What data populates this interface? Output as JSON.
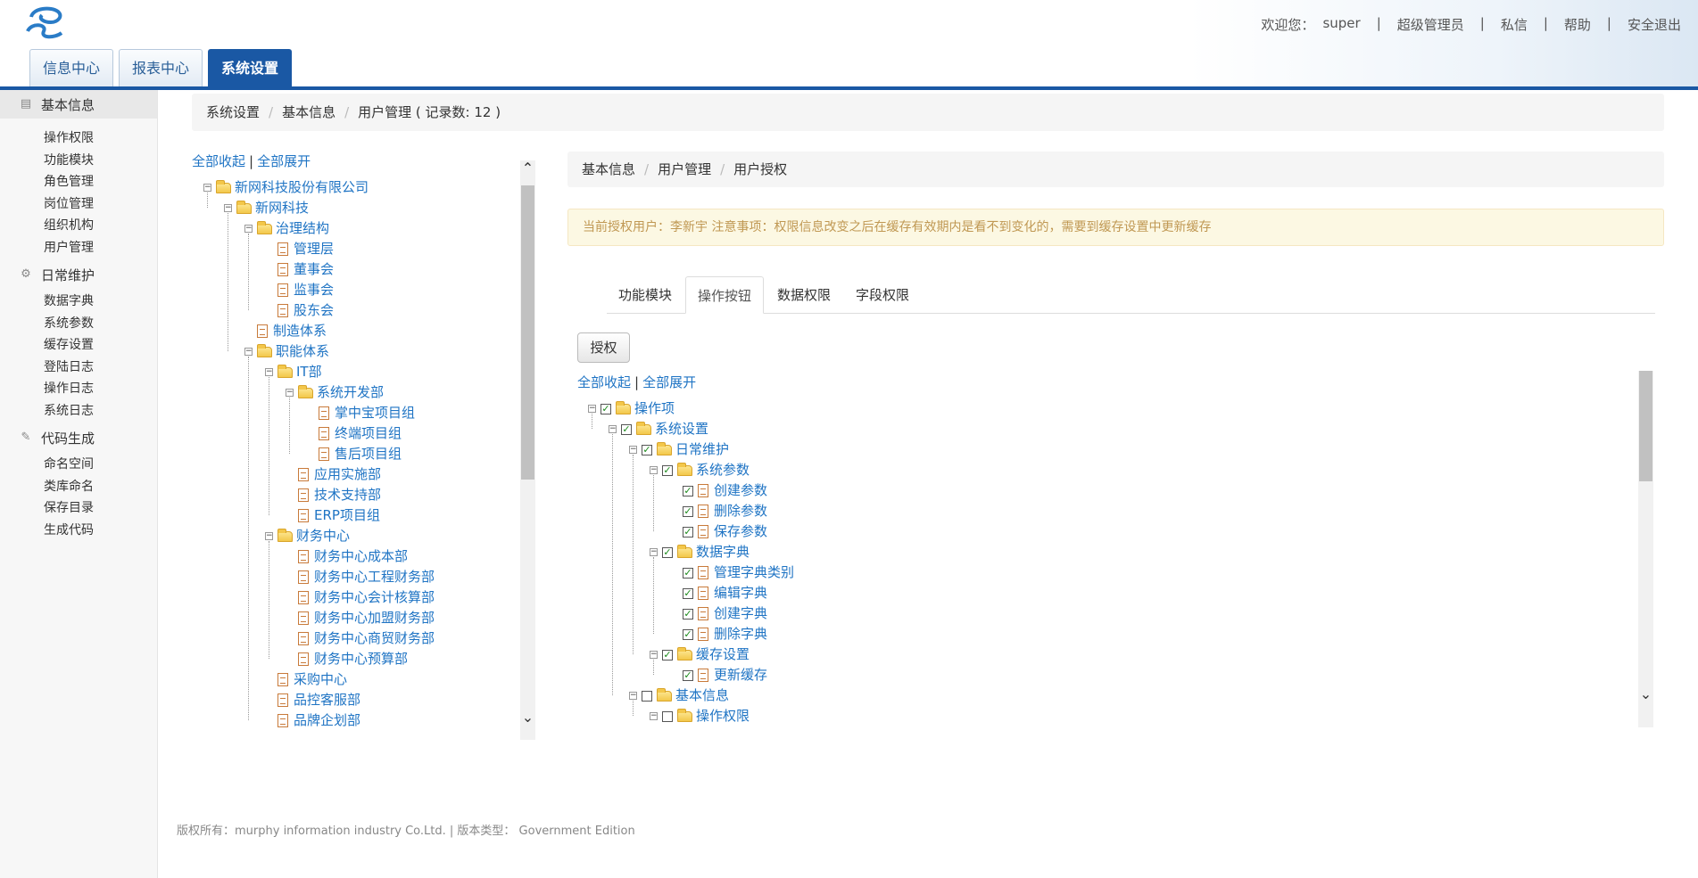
{
  "header": {
    "welcome": "欢迎您：",
    "user": "super",
    "role": "超级管理员",
    "links": [
      "私信",
      "帮助",
      "安全退出"
    ],
    "tabs": [
      {
        "label": "信息中心",
        "active": false
      },
      {
        "label": "报表中心",
        "active": false
      },
      {
        "label": "系统设置",
        "active": true
      }
    ],
    "accent": "#1a58a4"
  },
  "sidebar": {
    "groups": [
      {
        "label": "基本信息",
        "icon": "list-icon",
        "items": [
          "操作权限",
          "功能模块",
          "角色管理",
          "岗位管理",
          "组织机构",
          "用户管理"
        ]
      },
      {
        "label": "日常维护",
        "icon": "gear-icon",
        "items": [
          "数据字典",
          "系统参数",
          "缓存设置",
          "登陆日志",
          "操作日志",
          "系统日志"
        ]
      },
      {
        "label": "代码生成",
        "icon": "pencil-icon",
        "items": [
          "命名空间",
          "类库命名",
          "保存目录",
          "生成代码"
        ]
      }
    ]
  },
  "breadcrumb": {
    "items": [
      "系统设置",
      "基本信息"
    ],
    "current": "用户管理 ( 记录数: 12 )"
  },
  "org_tree": {
    "collapse_all": "全部收起",
    "expand_all": "全部展开",
    "nodes": [
      {
        "label": "新网科技股份有限公司",
        "level": 0,
        "type": "folder"
      },
      {
        "label": "新网科技",
        "level": 1,
        "type": "folder"
      },
      {
        "label": "治理结构",
        "level": 2,
        "type": "folder"
      },
      {
        "label": "管理层",
        "level": 3,
        "type": "doc"
      },
      {
        "label": "董事会",
        "level": 3,
        "type": "doc"
      },
      {
        "label": "监事会",
        "level": 3,
        "type": "doc"
      },
      {
        "label": "股东会",
        "level": 3,
        "type": "doc"
      },
      {
        "label": "制造体系",
        "level": 2,
        "type": "doc"
      },
      {
        "label": "职能体系",
        "level": 2,
        "type": "folder"
      },
      {
        "label": "IT部",
        "level": 3,
        "type": "folder"
      },
      {
        "label": "系统开发部",
        "level": 4,
        "type": "folder"
      },
      {
        "label": "掌中宝项目组",
        "level": 5,
        "type": "doc"
      },
      {
        "label": "终端项目组",
        "level": 5,
        "type": "doc"
      },
      {
        "label": "售后项目组",
        "level": 5,
        "type": "doc"
      },
      {
        "label": "应用实施部",
        "level": 4,
        "type": "doc"
      },
      {
        "label": "技术支持部",
        "level": 4,
        "type": "doc"
      },
      {
        "label": "ERP项目组",
        "level": 4,
        "type": "doc"
      },
      {
        "label": "财务中心",
        "level": 3,
        "type": "folder"
      },
      {
        "label": "财务中心成本部",
        "level": 4,
        "type": "doc"
      },
      {
        "label": "财务中心工程财务部",
        "level": 4,
        "type": "doc"
      },
      {
        "label": "财务中心会计核算部",
        "level": 4,
        "type": "doc"
      },
      {
        "label": "财务中心加盟财务部",
        "level": 4,
        "type": "doc"
      },
      {
        "label": "财务中心商贸财务部",
        "level": 4,
        "type": "doc"
      },
      {
        "label": "财务中心预算部",
        "level": 4,
        "type": "doc"
      },
      {
        "label": "采购中心",
        "level": 3,
        "type": "doc"
      },
      {
        "label": "品控客服部",
        "level": 3,
        "type": "doc"
      },
      {
        "label": "品牌企划部",
        "level": 3,
        "type": "doc"
      }
    ]
  },
  "auth_panel": {
    "breadcrumb": [
      "基本信息",
      "用户管理",
      "用户授权"
    ],
    "notice": "当前授权用户：李新宇 注意事项：权限信息改变之后在缓存有效期内是看不到变化的，需要到缓存设置中更新缓存",
    "tabs": [
      {
        "label": "功能模块",
        "active": false
      },
      {
        "label": "操作按钮",
        "active": true
      },
      {
        "label": "数据权限",
        "active": false
      },
      {
        "label": "字段权限",
        "active": false
      }
    ],
    "grant_button": "授权",
    "collapse_all": "全部收起",
    "expand_all": "全部展开",
    "nodes": [
      {
        "label": "操作项",
        "level": 0,
        "type": "folder",
        "checked": true
      },
      {
        "label": "系统设置",
        "level": 1,
        "type": "folder",
        "checked": true
      },
      {
        "label": "日常维护",
        "level": 2,
        "type": "folder",
        "checked": true
      },
      {
        "label": "系统参数",
        "level": 3,
        "type": "folder",
        "checked": true
      },
      {
        "label": "创建参数",
        "level": 4,
        "type": "doc",
        "checked": true
      },
      {
        "label": "删除参数",
        "level": 4,
        "type": "doc",
        "checked": true
      },
      {
        "label": "保存参数",
        "level": 4,
        "type": "doc",
        "checked": true
      },
      {
        "label": "数据字典",
        "level": 3,
        "type": "folder",
        "checked": true
      },
      {
        "label": "管理字典类别",
        "level": 4,
        "type": "doc",
        "checked": true
      },
      {
        "label": "编辑字典",
        "level": 4,
        "type": "doc",
        "checked": true
      },
      {
        "label": "创建字典",
        "level": 4,
        "type": "doc",
        "checked": true
      },
      {
        "label": "删除字典",
        "level": 4,
        "type": "doc",
        "checked": true
      },
      {
        "label": "缓存设置",
        "level": 3,
        "type": "folder",
        "checked": true
      },
      {
        "label": "更新缓存",
        "level": 4,
        "type": "doc",
        "checked": true
      },
      {
        "label": "基本信息",
        "level": 2,
        "type": "folder",
        "checked": false
      },
      {
        "label": "操作权限",
        "level": 3,
        "type": "folder",
        "checked": false
      }
    ]
  },
  "footer": {
    "text": "版权所有：murphy information industry Co.Ltd. | 版本类型： Government Edition"
  }
}
